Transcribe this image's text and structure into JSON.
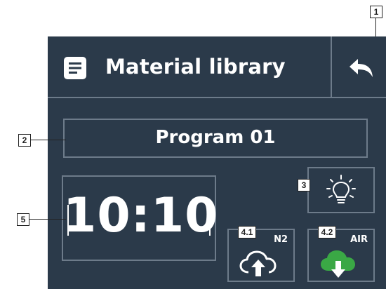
{
  "header": {
    "title": "Material library",
    "menu_icon": "document-icon",
    "back_icon": "back-arrow-icon"
  },
  "program": {
    "label": "Program 01"
  },
  "clock": {
    "time": "10:10"
  },
  "buttons": {
    "light": {
      "icon": "light-bulb-icon"
    },
    "n2": {
      "label": "N2",
      "icon": "cloud-upload-icon",
      "icon_color": "#ffffff"
    },
    "air": {
      "label": "AIR",
      "icon": "cloud-download-icon",
      "icon_color": "#3aa845"
    }
  },
  "callouts": {
    "c1": "1",
    "c2": "2",
    "c3": "3",
    "c41": "4.1",
    "c42": "4.2",
    "c5": "5"
  },
  "colors": {
    "panel_bg": "#2b3a4a",
    "divider": "#6d7b8a",
    "text": "#ffffff",
    "air_green": "#3aa845"
  }
}
